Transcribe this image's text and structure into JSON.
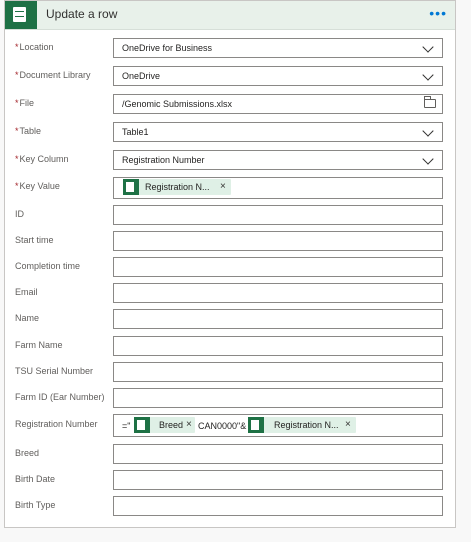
{
  "card": {
    "title": "Update a row",
    "more_label": "•••"
  },
  "colors": {
    "excel_green": "#1e7145",
    "header_bg": "#e8f1ea",
    "token_bg": "#dff0e6",
    "required": "#a4262c",
    "accent": "#0078d4"
  },
  "fields": {
    "location": {
      "label": "Location",
      "required": "*",
      "value": "OneDrive for Business",
      "icon": "chevron-down-icon"
    },
    "document_library": {
      "label": "Document Library",
      "required": "*",
      "value": "OneDrive",
      "icon": "chevron-down-icon"
    },
    "file": {
      "label": "File",
      "required": "*",
      "value": "/Genomic Submissions.xlsx",
      "icon": "folder-icon"
    },
    "table": {
      "label": "Table",
      "required": "*",
      "value": "Table1",
      "icon": "chevron-down-icon"
    },
    "key_column": {
      "label": "Key Column",
      "required": "*",
      "value": "Registration Number",
      "icon": "chevron-down-icon"
    },
    "key_value": {
      "label": "Key Value",
      "required": "*",
      "token": "Registration N...",
      "close": "×"
    },
    "id": {
      "label": "ID"
    },
    "start_time": {
      "label": "Start time"
    },
    "completion_time": {
      "label": "Completion time"
    },
    "email": {
      "label": "Email"
    },
    "name": {
      "label": "Name"
    },
    "farm_name": {
      "label": "Farm Name"
    },
    "tsu_serial_number": {
      "label": "TSU Serial Number"
    },
    "farm_id": {
      "label": "Farm ID (Ear Number)"
    },
    "registration_number": {
      "label": "Registration Number",
      "prefix": "=\"",
      "token1": "Breed",
      "middle": "CAN0000\"&",
      "token2": "Registration N...",
      "close": "×"
    },
    "breed": {
      "label": "Breed"
    },
    "birth_date": {
      "label": "Birth Date"
    },
    "birth_type": {
      "label": "Birth Type"
    }
  }
}
